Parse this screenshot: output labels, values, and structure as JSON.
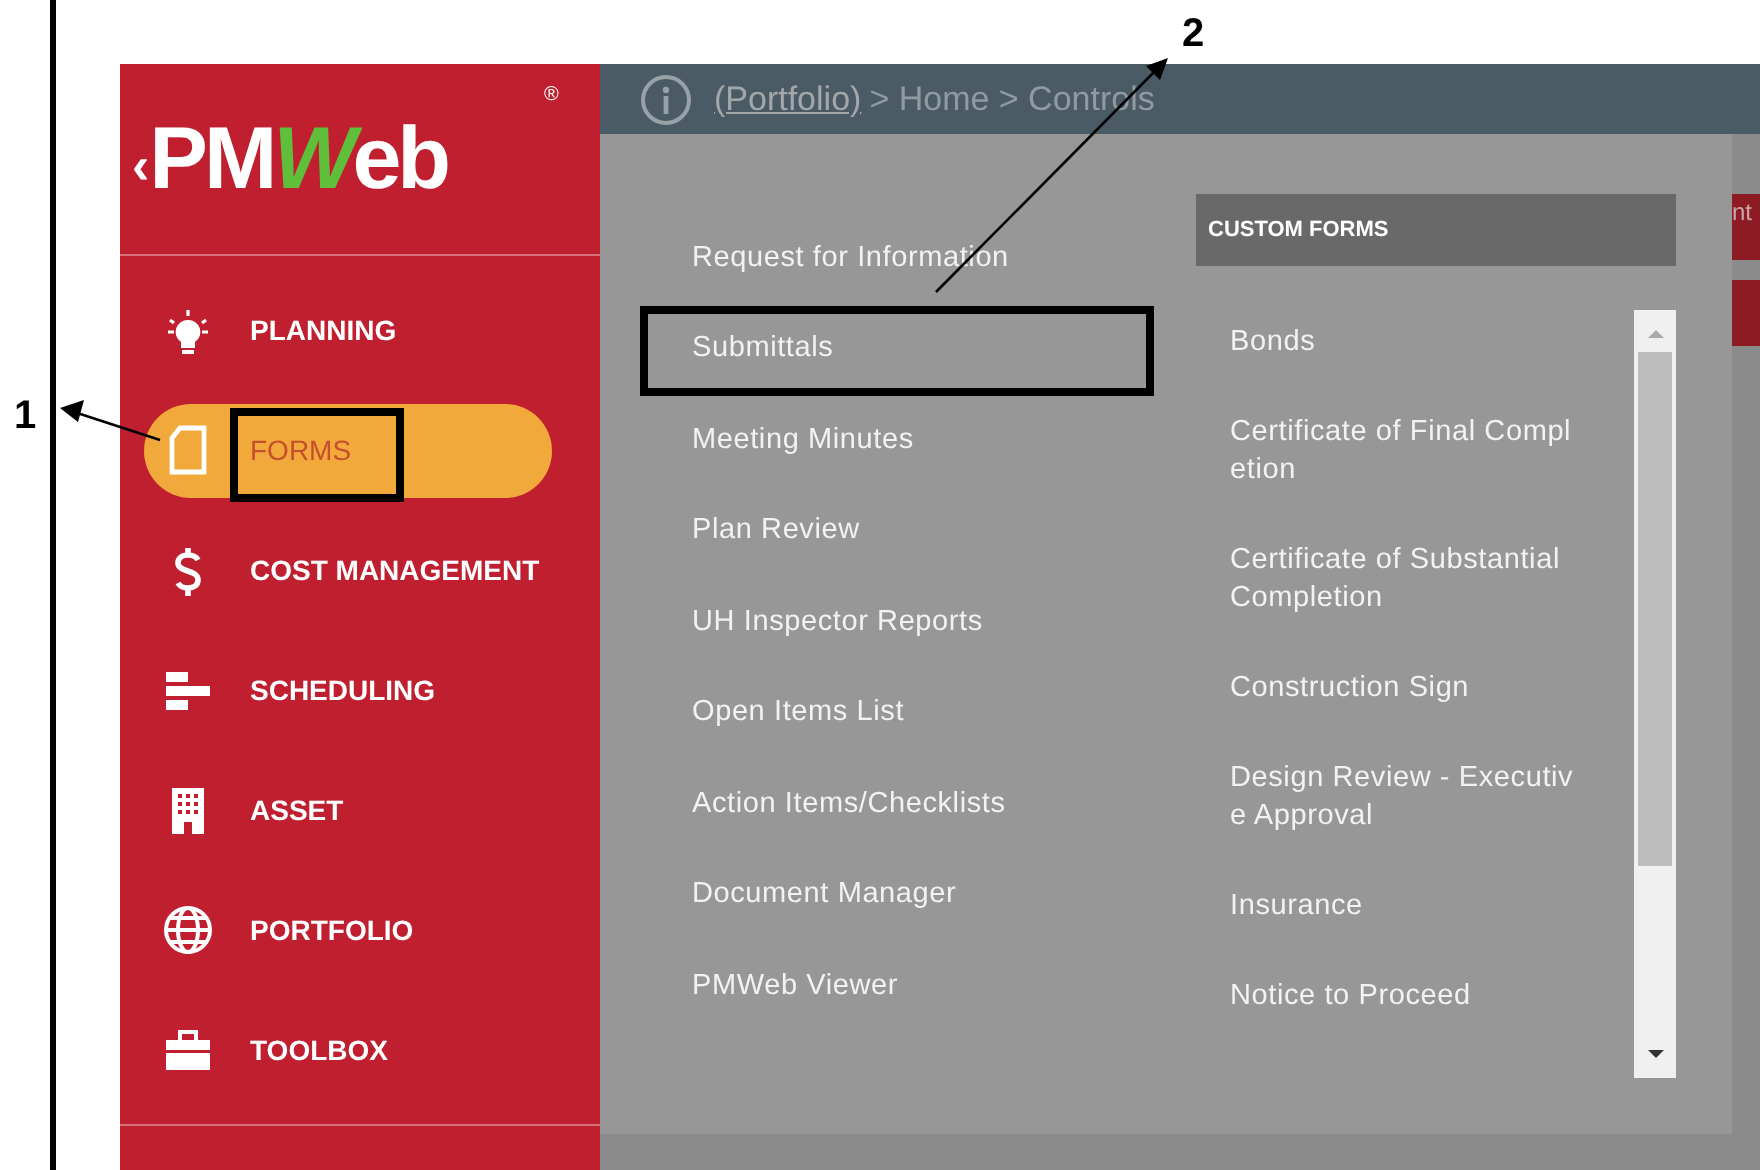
{
  "annotations": [
    {
      "label": "1"
    },
    {
      "label": "2"
    }
  ],
  "logo": {
    "caret": "‹",
    "before": "PM",
    "accent": "W",
    "after": "eb",
    "mark": "®"
  },
  "sidebar": {
    "items": [
      {
        "kind": "bulb",
        "label": "PLANNING",
        "selected": false
      },
      {
        "kind": "document",
        "label": "FORMS",
        "selected": true
      },
      {
        "kind": "dollar",
        "label": "COST MANAGEMENT",
        "selected": false
      },
      {
        "kind": "bars",
        "label": "SCHEDULING",
        "selected": false
      },
      {
        "kind": "building",
        "label": "ASSET",
        "selected": false
      },
      {
        "kind": "globe",
        "label": "PORTFOLIO",
        "selected": false
      },
      {
        "kind": "toolbox",
        "label": "TOOLBOX",
        "selected": false
      }
    ]
  },
  "breadcrumb": {
    "link": "(Portfolio)",
    "trail": "> Home > Controls"
  },
  "menu": {
    "items": [
      "Request for Information",
      "Submittals",
      "Meeting Minutes",
      "Plan Review",
      "UH Inspector Reports",
      "Open Items List",
      "Action Items/Checklists",
      "Document Manager",
      "PMWeb Viewer"
    ]
  },
  "custom_forms": {
    "title": "CUSTOM FORMS",
    "items": [
      {
        "lines": [
          "Bonds"
        ]
      },
      {
        "lines": [
          "Certificate of Final Compl",
          "etion"
        ]
      },
      {
        "lines": [
          "Certificate of Substantial",
          "Completion"
        ]
      },
      {
        "lines": [
          "Construction Sign"
        ]
      },
      {
        "lines": [
          "Design Review - Executiv",
          "e Approval"
        ]
      },
      {
        "lines": [
          "Insurance"
        ]
      },
      {
        "lines": [
          "Notice to Proceed"
        ]
      }
    ]
  },
  "right_strip": {
    "cut_label": "nt"
  }
}
